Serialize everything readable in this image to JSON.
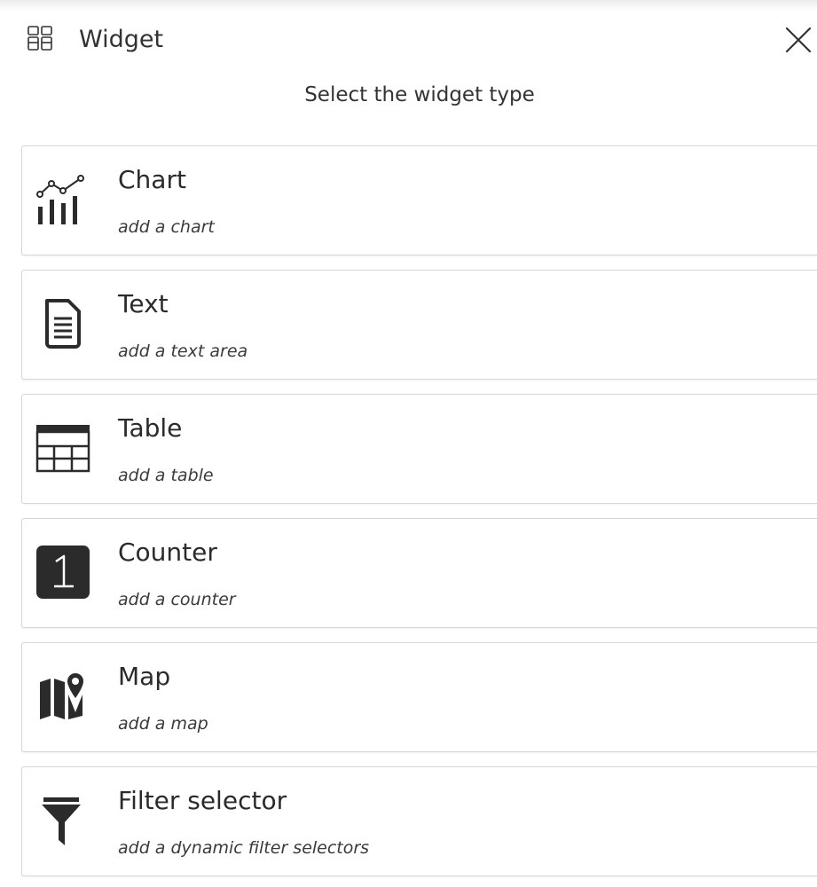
{
  "header": {
    "title": "Widget",
    "icon": "widget-grid-icon",
    "close_icon": "close-icon"
  },
  "subtitle": "Select the widget type",
  "widgets": [
    {
      "label": "Chart",
      "description": "add a chart",
      "icon": "chart-icon"
    },
    {
      "label": "Text",
      "description": "add a text area",
      "icon": "text-document-icon"
    },
    {
      "label": "Table",
      "description": "add a table",
      "icon": "table-icon"
    },
    {
      "label": "Counter",
      "description": "add a counter",
      "icon": "counter-icon"
    },
    {
      "label": "Map",
      "description": "add a map",
      "icon": "map-icon"
    },
    {
      "label": "Filter selector",
      "description": "add a dynamic filter selectors",
      "icon": "filter-icon"
    }
  ],
  "colors": {
    "icon": "#2b2b2b",
    "border": "#d6d6d6",
    "text": "#333333"
  }
}
